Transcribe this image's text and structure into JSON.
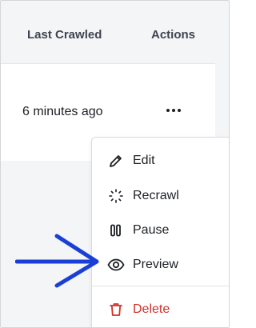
{
  "table": {
    "headers": {
      "last_crawled": "Last Crawled",
      "actions": "Actions"
    },
    "row": {
      "last_crawled": "6 minutes ago",
      "more_icon": "ellipsis-horizontal-icon"
    }
  },
  "menu": {
    "items": [
      {
        "label": "Edit",
        "icon": "pencil-icon"
      },
      {
        "label": "Recrawl",
        "icon": "loader-dots-icon"
      },
      {
        "label": "Pause",
        "icon": "pause-icon"
      },
      {
        "label": "Preview",
        "icon": "eye-icon"
      },
      {
        "label": "Delete",
        "icon": "trash-icon"
      }
    ]
  },
  "colors": {
    "delete": "#d0312d",
    "annotation_arrow": "#1a3fd6",
    "header_bg": "#f4f5f7"
  }
}
